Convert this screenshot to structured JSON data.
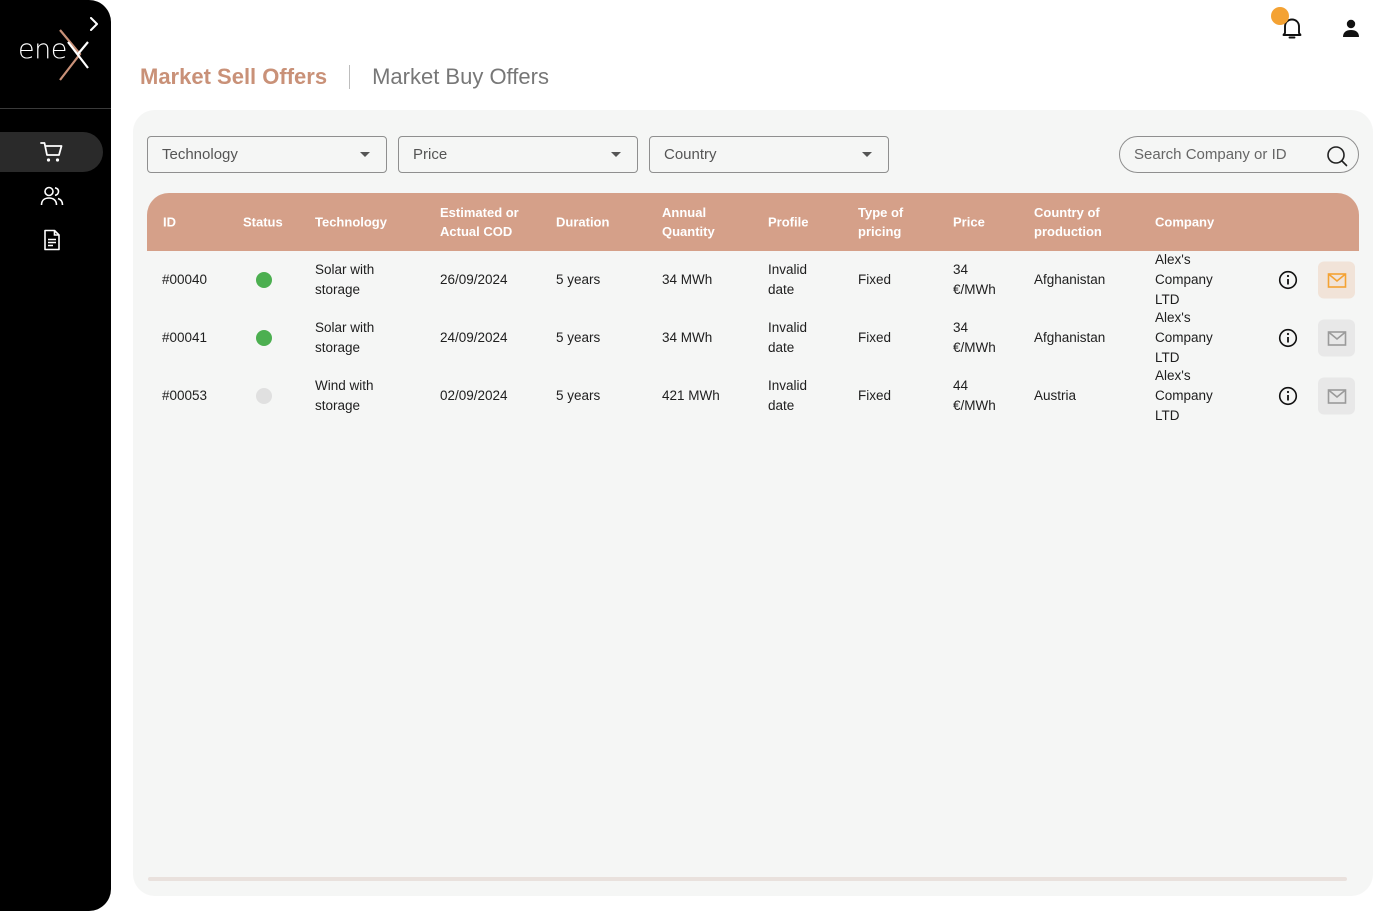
{
  "brand": {
    "logo_text": "ene",
    "logo_x": "x"
  },
  "colors": {
    "accent": "#c99178",
    "header_bg": "#d5a089",
    "status_active": "#4caf50",
    "status_inactive": "#e0e0e0",
    "notification": "#f4a233",
    "mail_active": "#f4a233"
  },
  "sidebar": {
    "items": [
      {
        "icon": "cart-icon",
        "active": true
      },
      {
        "icon": "users-icon",
        "active": false
      },
      {
        "icon": "document-icon",
        "active": false
      }
    ]
  },
  "tabs": [
    {
      "label": "Market Sell Offers",
      "active": true
    },
    {
      "label": "Market Buy Offers",
      "active": false
    }
  ],
  "filters": {
    "technology": "Technology",
    "price": "Price",
    "country": "Country"
  },
  "search": {
    "placeholder": "Search Company or ID"
  },
  "table": {
    "headers": {
      "id": "ID",
      "status": "Status",
      "technology": "Technology",
      "cod": "Estimated or Actual COD",
      "duration": "Duration",
      "quantity": "Annual Quantity",
      "profile": "Profile",
      "pricing": "Type of pricing",
      "price": "Price",
      "country": "Country of production",
      "company": "Company"
    },
    "rows": [
      {
        "id": "#00040",
        "status": "active",
        "technology": "Solar with storage",
        "cod": "26/09/2024",
        "duration": "5 years",
        "quantity": "34 MWh",
        "profile": "Invalid date",
        "pricing": "Fixed",
        "price": "34 €/MWh",
        "country": "Afghanistan",
        "company": "Alex's Company LTD",
        "mail_active": true
      },
      {
        "id": "#00041",
        "status": "active",
        "technology": "Solar with storage",
        "cod": "24/09/2024",
        "duration": "5 years",
        "quantity": "34 MWh",
        "profile": "Invalid date",
        "pricing": "Fixed",
        "price": "34 €/MWh",
        "country": "Afghanistan",
        "company": "Alex's Company LTD",
        "mail_active": false
      },
      {
        "id": "#00053",
        "status": "inactive",
        "technology": "Wind with storage",
        "cod": "02/09/2024",
        "duration": "5 years",
        "quantity": "421 MWh",
        "profile": "Invalid date",
        "pricing": "Fixed",
        "price": "44 €/MWh",
        "country": "Austria",
        "company": "Alex's Company LTD",
        "mail_active": false
      }
    ]
  }
}
